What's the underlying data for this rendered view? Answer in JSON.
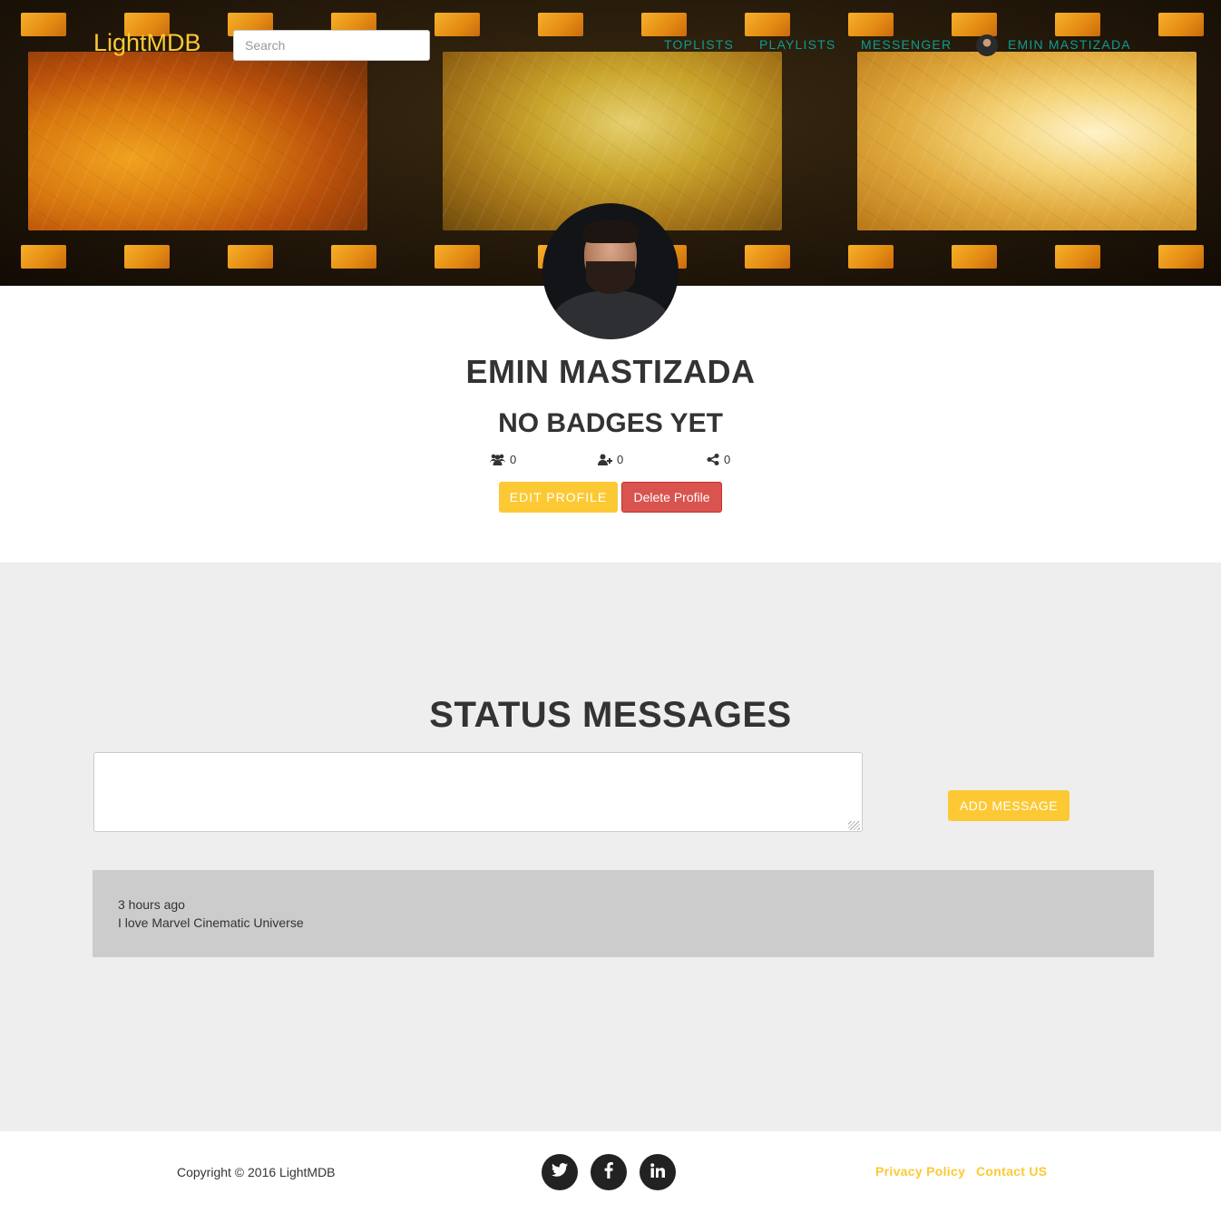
{
  "navbar": {
    "brand": "LightMDB",
    "search_placeholder": "Search",
    "links": [
      "TOPLISTS",
      "PLAYLISTS",
      "MESSENGER"
    ],
    "user_name": "EMIN MASTIZADA"
  },
  "profile": {
    "name": "EMIN MASTIZADA",
    "badges": "NO BADGES YET",
    "stats": {
      "followers": "0",
      "following": "0",
      "shares": "0"
    },
    "edit_button": "Edit Profile",
    "delete_button": "Delete Profile"
  },
  "status": {
    "title": "STATUS MESSAGES",
    "input_value": "",
    "add_button": "Add Message",
    "messages": [
      {
        "time": "3 hours ago",
        "text": "I love Marvel Cinematic Universe"
      }
    ]
  },
  "footer": {
    "copyright": "Copyright © 2016 LightMDB",
    "social": [
      "twitter-icon",
      "facebook-icon",
      "linkedin-icon"
    ],
    "links": [
      "Privacy Policy",
      "Contact US"
    ]
  },
  "colors": {
    "accent": "#fcc935",
    "nav_link": "#0d9c93",
    "danger": "#d9534f",
    "section_bg": "#eeeeee",
    "card_bg": "#cccccc"
  }
}
